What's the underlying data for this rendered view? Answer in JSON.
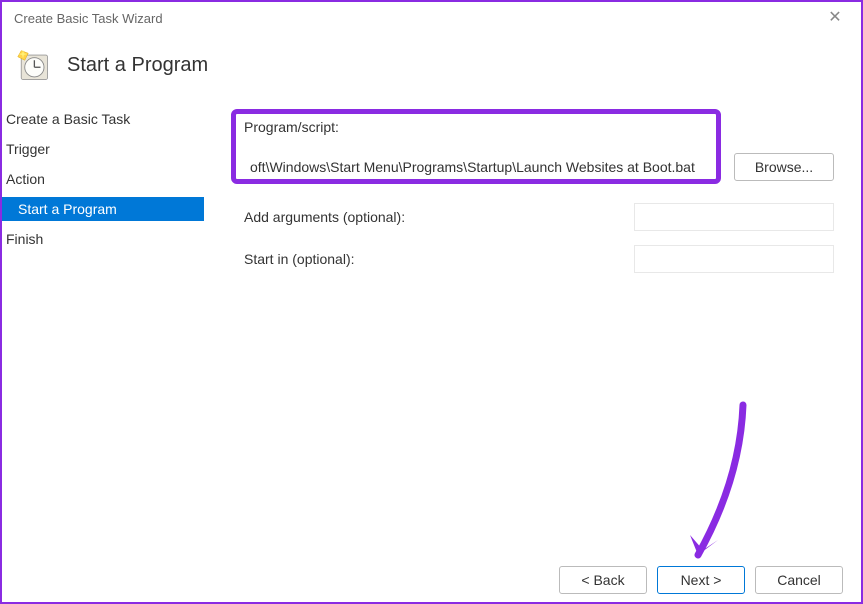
{
  "window": {
    "title": "Create Basic Task Wizard"
  },
  "header": {
    "title": "Start a Program"
  },
  "sidebar": {
    "items": [
      {
        "label": "Create a Basic Task",
        "selected": false
      },
      {
        "label": "Trigger",
        "selected": false
      },
      {
        "label": "Action",
        "selected": false
      },
      {
        "label": "Start a Program",
        "selected": true
      },
      {
        "label": "Finish",
        "selected": false
      }
    ]
  },
  "content": {
    "program_label": "Program/script:",
    "program_value": "oft\\Windows\\Start Menu\\Programs\\Startup\\Launch Websites at Boot.bat",
    "browse_label": "Browse...",
    "args_label": "Add arguments (optional):",
    "args_value": "",
    "startin_label": "Start in (optional):",
    "startin_value": ""
  },
  "buttons": {
    "back": "< Back",
    "next": "Next >",
    "cancel": "Cancel"
  },
  "annotations": {
    "highlight": "program-script-highlight",
    "arrow": "next-button-arrow"
  }
}
